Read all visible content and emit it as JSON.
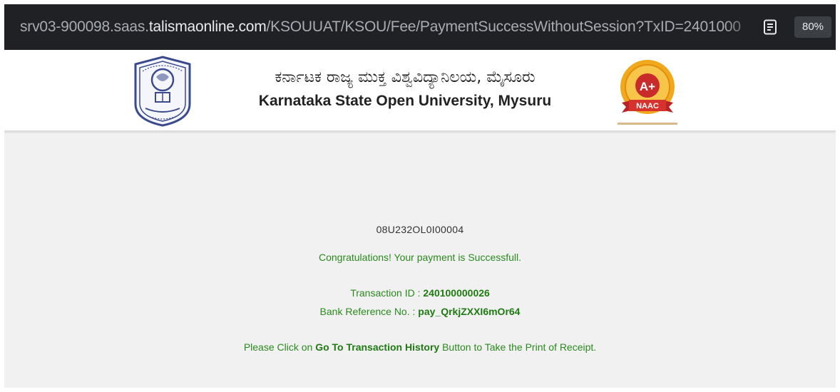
{
  "browser": {
    "url_prefix": "srv03-900098.saas.",
    "url_host": "talismaonline.com",
    "url_path": "/KSOUUAT/KSOU/Fee/PaymentSuccessWithoutSession?TxID=2401000",
    "reader_icon": "reader-mode-icon",
    "zoom": "80%"
  },
  "header": {
    "title_kannada": "ಕರ್ನಾಟಕ ರಾಜ್ಯ ಮುಕ್ತ ವಿಶ್ವವಿದ್ಯಾನಿಲಯ, ಮೈಸೂರು",
    "title_english": "Karnataka State Open University, Mysuru",
    "naac_grade": "A+",
    "naac_label": "NAAC",
    "colors": {
      "naac_gold": "#f2a81d",
      "naac_red": "#d7332e"
    }
  },
  "content": {
    "ref_code": "08U232OL0I00004",
    "congrats": "Congratulations! Your payment is Successfull.",
    "txn_label": "Transaction ID : ",
    "txn_value": "240100000026",
    "bank_label": "Bank Reference No. : ",
    "bank_value": "pay_QrkjZXXI6mOr64",
    "instr_prefix": "Please Click on ",
    "instr_bold": "Go To Transaction History",
    "instr_suffix": " Button to Take the Print of Receipt.",
    "colors": {
      "success_green": "#2a8a1e",
      "page_bg": "#f1f1f1"
    }
  }
}
